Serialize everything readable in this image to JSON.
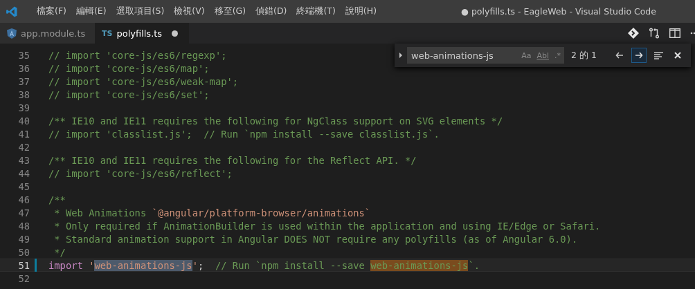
{
  "menu_bar": {
    "items": [
      "檔案(F)",
      "編輯(E)",
      "選取項目(S)",
      "檢視(V)",
      "移至(G)",
      "偵錯(D)",
      "終端機(T)",
      "說明(H)"
    ]
  },
  "window_title": "● polyfills.ts - EagleWeb - Visual Studio Code",
  "tabs": [
    {
      "label": "app.module.ts",
      "kind": "angular",
      "selected": false,
      "modified": false
    },
    {
      "label": "polyfills.ts",
      "kind": "ts",
      "icon_text": "TS",
      "selected": true,
      "modified": true
    }
  ],
  "find_widget": {
    "value": "web-animations-js",
    "options": [
      "Aa",
      "Abl",
      ".*"
    ],
    "match_count": "2 的 1",
    "next_selected": true
  },
  "code_lines": [
    {
      "number": "35",
      "current": false,
      "tokens": [
        {
          "kind": "comment",
          "text": "// import 'core-js/es6/regexp';"
        }
      ]
    },
    {
      "number": "36",
      "current": false,
      "tokens": [
        {
          "kind": "comment",
          "text": "// import 'core-js/es6/map';"
        }
      ]
    },
    {
      "number": "37",
      "current": false,
      "tokens": [
        {
          "kind": "comment",
          "text": "// import 'core-js/es6/weak-map';"
        }
      ]
    },
    {
      "number": "38",
      "current": false,
      "tokens": [
        {
          "kind": "comment",
          "text": "// import 'core-js/es6/set';"
        }
      ]
    },
    {
      "number": "39",
      "current": false
    },
    {
      "number": "40",
      "current": false,
      "tokens": [
        {
          "kind": "comment",
          "text": "/** IE10 and IE11 requires the following for NgClass support on SVG elements */"
        }
      ]
    },
    {
      "number": "41",
      "current": false,
      "tokens": [
        {
          "kind": "comment",
          "text": "// import 'classlist.js';  // Run `npm install --save classlist.js`."
        }
      ]
    },
    {
      "number": "42",
      "current": false
    },
    {
      "number": "43",
      "current": false,
      "tokens": [
        {
          "kind": "comment",
          "text": "/** IE10 and IE11 requires the following for the Reflect API. */"
        }
      ]
    },
    {
      "number": "44",
      "current": false,
      "tokens": [
        {
          "kind": "comment",
          "text": "// import 'core-js/es6/reflect';"
        }
      ]
    },
    {
      "number": "45",
      "current": false
    },
    {
      "number": "46",
      "current": false,
      "tokens": [
        {
          "kind": "comment",
          "text": "/**"
        }
      ]
    },
    {
      "number": "47",
      "current": false,
      "tokens": [
        {
          "kind": "comment",
          "text": " * Web Animations "
        },
        {
          "kind": "code",
          "text": "`@angular/platform-browser/animations`"
        }
      ]
    },
    {
      "number": "48",
      "current": false,
      "tokens": [
        {
          "kind": "comment",
          "text": " * Only required if AnimationBuilder is used within the application and using IE/Edge or Safari."
        }
      ]
    },
    {
      "number": "49",
      "current": false,
      "tokens": [
        {
          "kind": "comment",
          "text": " * Standard animation support in Angular DOES NOT require any polyfills (as of Angular 6.0)."
        }
      ]
    },
    {
      "number": "50",
      "current": false,
      "tokens": [
        {
          "kind": "comment",
          "text": " */"
        }
      ]
    },
    {
      "number": "51",
      "current": true,
      "tokens": [
        {
          "kind": "keyword",
          "text": "import "
        },
        {
          "kind": "string",
          "text": "'"
        },
        {
          "kind": "selected_string",
          "text": "web-animations-js"
        },
        {
          "kind": "string",
          "text": "'"
        },
        {
          "kind": "plain",
          "text": ";  "
        },
        {
          "kind": "comment",
          "text": "// Run `npm install --save "
        },
        {
          "kind": "matched_comment",
          "text": "web-animations-js"
        },
        {
          "kind": "comment",
          "text": "`."
        }
      ]
    },
    {
      "number": "52",
      "current": false
    }
  ]
}
